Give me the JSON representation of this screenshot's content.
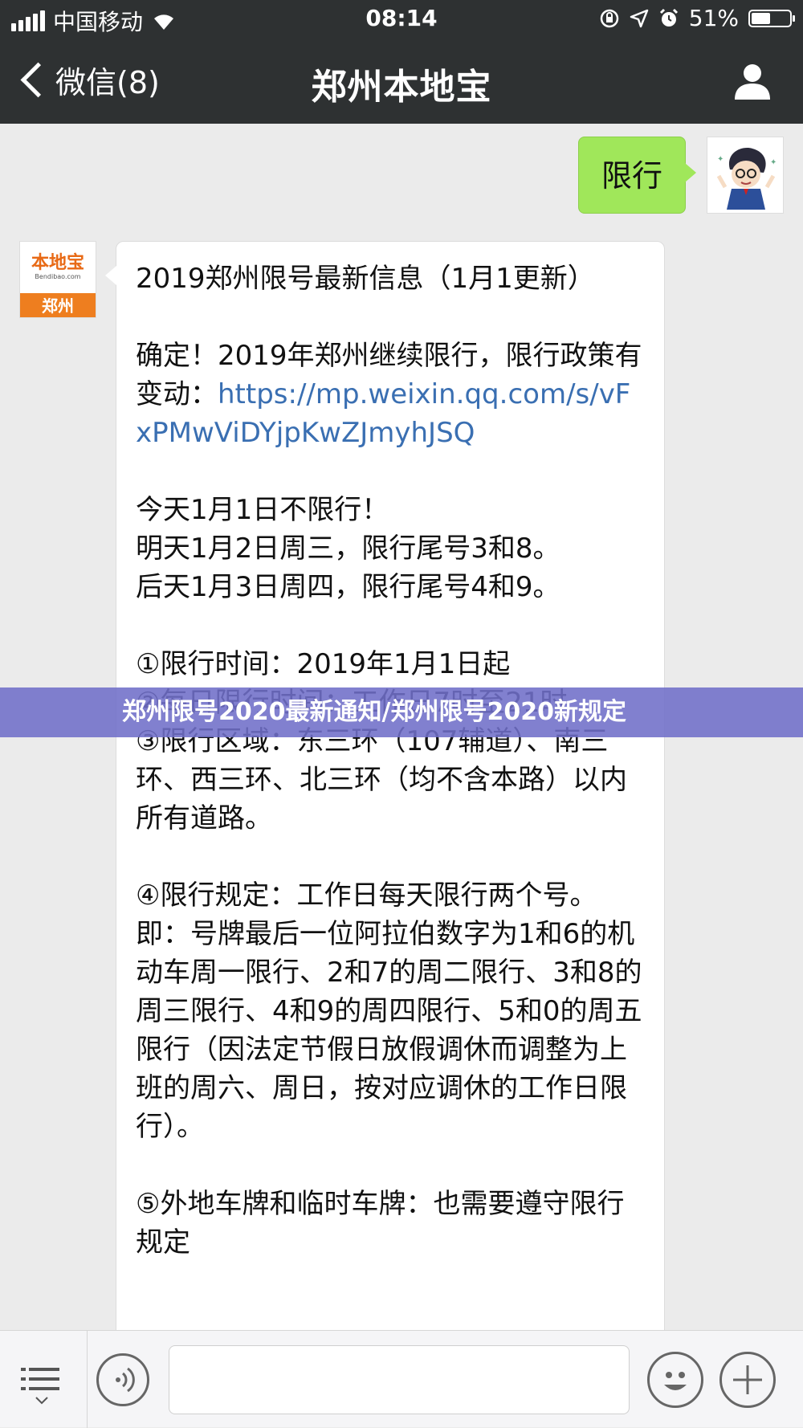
{
  "status_bar": {
    "carrier": "中国移动",
    "time": "08:14",
    "battery": "51%",
    "battery_level": 0.51
  },
  "nav": {
    "back_label": "微信(8)",
    "title": "郑州本地宝"
  },
  "messages": {
    "sent_text": "限行",
    "bot_avatar": {
      "brand": "本地宝",
      "domain": "Bendibao.com",
      "city": "郑州"
    },
    "reply": {
      "title": "2019郑州限号最新信息（1月1更新）",
      "p1_text": "确定！2019年郑州继续限行，限行政策有变动：",
      "p1_link": "https://mp.weixin.qq.com/s/vFxPMwViDYjpKwZJmyhJSQ",
      "p2": "今天1月1日不限行！\n明天1月2日周三，限行尾号3和8。\n后天1月3日周四，限行尾号4和9。",
      "p3": "①限行时间：2019年1月1日起\n②每日限行时间：工作日7时至21时\n③限行区域：东三环（107辅道）、南三环、西三环、北三环（均不含本路）以内所有道路。",
      "p4": "④限行规定：工作日每天限行两个号。即：号牌最后一位阿拉伯数字为1和6的机动车周一限行、2和7的周二限行、3和8的周三限行、4和9的周四限行、5和0的周五限行（因法定节假日放假调休而调整为上班的周六、周日，按对应调休的工作日限行）。",
      "p5": "⑤外地车牌和临时车牌：也需要遵守限行规定"
    }
  },
  "banner": {
    "text": "郑州限号2020最新通知/郑州限号2020新规定"
  }
}
